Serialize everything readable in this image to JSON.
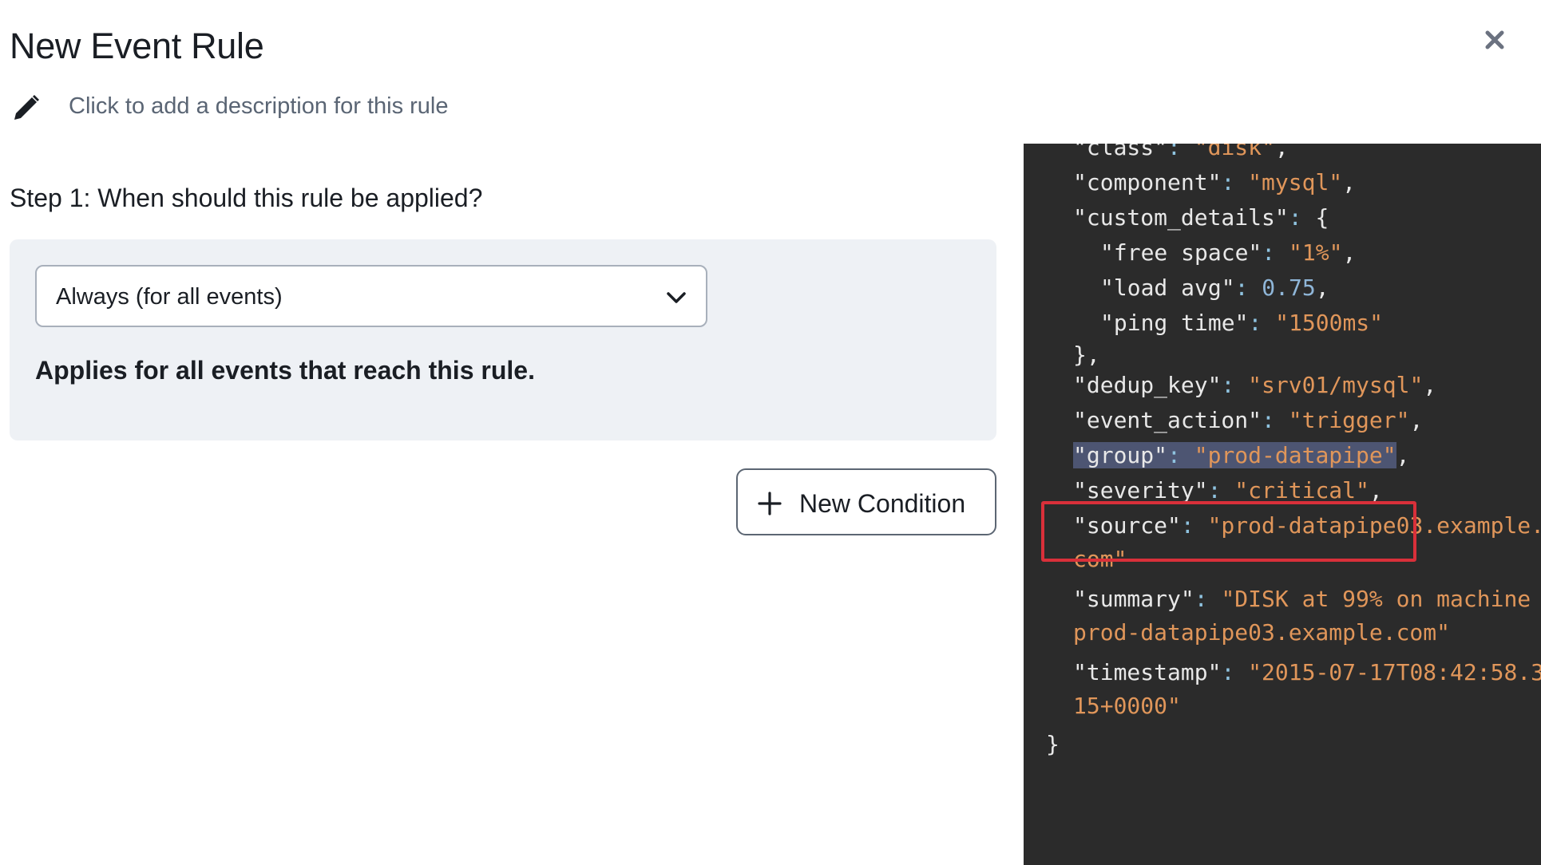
{
  "dialog": {
    "title": "New Event Rule",
    "description_placeholder": "Click to add a description for this rule"
  },
  "step1": {
    "heading": "Step 1: When should this rule be applied?",
    "select_value": "Always (for all events)",
    "applies_text": "Applies for all events that reach this rule.",
    "new_condition_label": "New Condition"
  },
  "payload": {
    "class_key": "\"class\"",
    "class_val": "\"disk\"",
    "component_key": "\"component\"",
    "component_val": "\"mysql\"",
    "custom_details_key": "\"custom_details\"",
    "free_space_key": "\"free space\"",
    "free_space_val": "\"1%\"",
    "load_avg_key": "\"load avg\"",
    "load_avg_val": "0.75",
    "ping_time_key": "\"ping time\"",
    "ping_time_val": "\"1500ms\"",
    "dedup_key_key": "\"dedup_key\"",
    "dedup_key_val": "\"srv01/mysql\"",
    "event_action_key": "\"event_action\"",
    "event_action_val": "\"trigger\"",
    "group_key": "\"group\"",
    "group_val": "\"prod-datapipe\"",
    "severity_key": "\"severity\"",
    "severity_val": "\"critical\"",
    "source_key": "\"source\"",
    "source_val_1": "\"prod-datapipe03.example.",
    "source_val_2": "com\"",
    "summary_key": "\"summary\"",
    "summary_val_1": "\"DISK at 99% on machine",
    "summary_val_2": "prod-datapipe03.example.com\"",
    "timestamp_key": "\"timestamp\"",
    "timestamp_val_1": "\"2015-07-17T08:42:58.3",
    "timestamp_val_2": "15+0000\""
  },
  "icons": {
    "close": "close-icon",
    "edit": "pencil-icon",
    "dropdown": "chevron-down-icon",
    "add": "plus-icon"
  }
}
